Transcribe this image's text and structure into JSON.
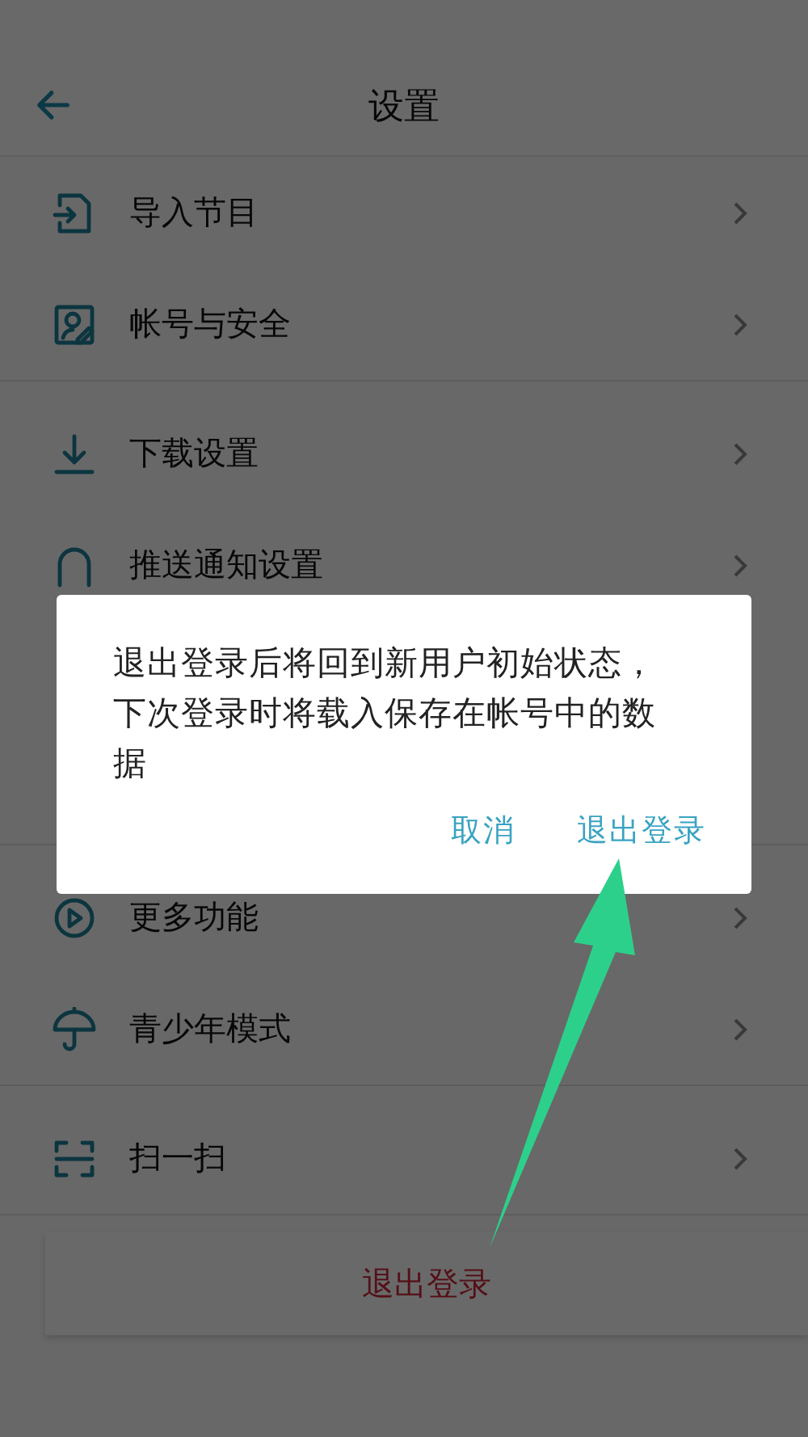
{
  "header": {
    "title": "设置"
  },
  "groups": [
    {
      "items": [
        {
          "kind": "import",
          "label": "导入节目"
        },
        {
          "kind": "account",
          "label": "帐号与安全"
        }
      ]
    },
    {
      "items": [
        {
          "kind": "download",
          "label": "下载设置"
        },
        {
          "kind": "bell",
          "label": "推送通知设置"
        }
      ]
    },
    {
      "items": [
        {
          "kind": "play",
          "label": "更多功能"
        },
        {
          "kind": "umbrella",
          "label": "青少年模式"
        }
      ]
    },
    {
      "items": [
        {
          "kind": "scan",
          "label": "扫一扫"
        }
      ]
    }
  ],
  "logout_button": "退出登录",
  "dialog": {
    "message": "退出登录后将回到新用户初始状态，下次登录时将载入保存在帐号中的数据",
    "buttons": [
      "取消",
      "退出登录"
    ]
  }
}
